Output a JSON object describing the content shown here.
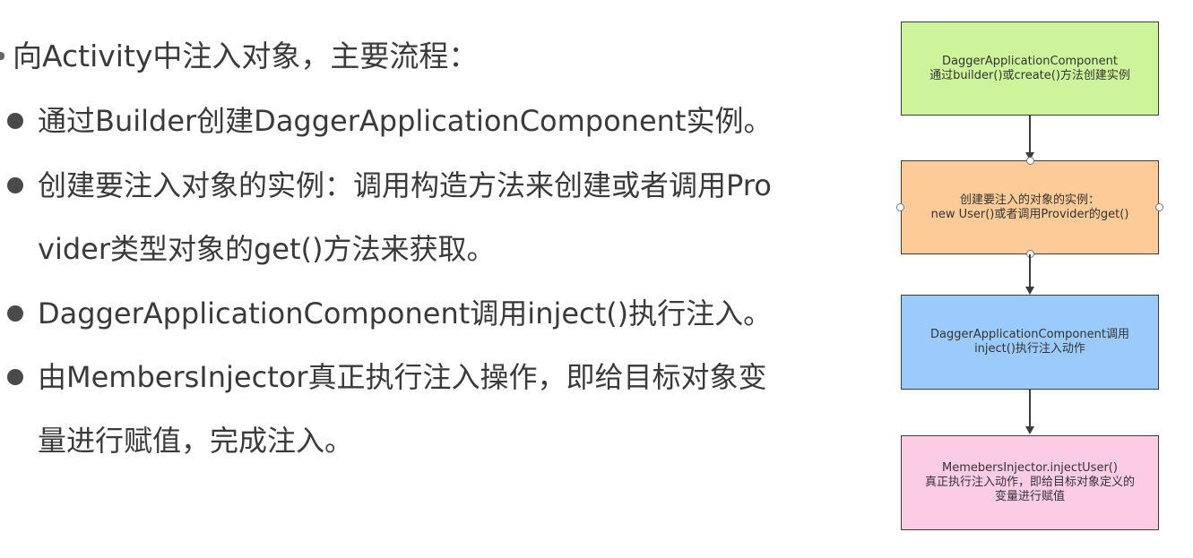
{
  "slide": {
    "heading": "向Activity中注入对象，主要流程：",
    "bullets": [
      {
        "lines": [
          "通过Builder创建DaggerApplicationComponent实例。"
        ]
      },
      {
        "lines": [
          "创建要注入对象的实例：调用构造方法来创建或者调用Pro",
          "vider类型对象的get()方法来获取。"
        ]
      },
      {
        "lines": [
          "DaggerApplicationComponent调用inject()执行注入。"
        ]
      },
      {
        "lines": [
          "由MembersInjector真正执行注入操作，即给目标对象变",
          "量进行赋值，完成注入。"
        ]
      }
    ]
  },
  "flowchart": {
    "boxes": [
      {
        "lines": [
          "DaggerApplicationComponent",
          "通过builder()或create()方法创建实例"
        ],
        "color": "#cdf49a"
      },
      {
        "lines": [
          "创建要注入的对象的实例：",
          "new User()或者调用Provider的get()"
        ],
        "color": "#fdcb98"
      },
      {
        "lines": [
          "DaggerApplicationComponent调用",
          "inject()执行注入动作"
        ],
        "color": "#9bcbfc"
      },
      {
        "lines": [
          "MemebersInjector.injectUser()",
          "真正执行注入动作，即给目标对象定义的",
          "变量进行赋值"
        ],
        "color": "#fccbe4"
      }
    ]
  }
}
